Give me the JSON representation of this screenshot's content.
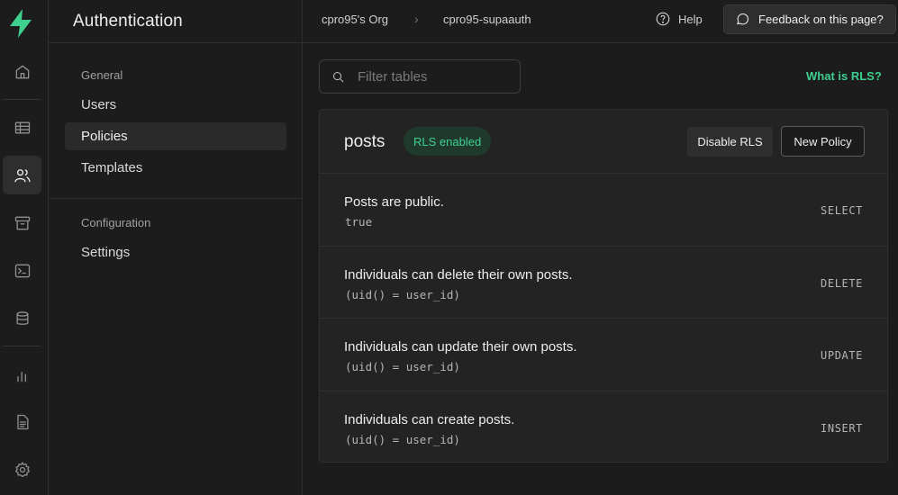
{
  "rail": {
    "icons": [
      "supabase-logo-icon",
      "home-icon",
      "table-editor-icon",
      "users-icon",
      "storage-icon",
      "sql-editor-icon",
      "database-icon",
      "reports-icon",
      "docs-icon",
      "settings-gear-icon"
    ],
    "active": "users-icon",
    "brand_color": "#3ecf8e"
  },
  "sidebar": {
    "title": "Authentication",
    "groups": [
      {
        "label": "General",
        "items": [
          "Users",
          "Policies",
          "Templates"
        ]
      },
      {
        "label": "Configuration",
        "items": [
          "Settings"
        ]
      }
    ],
    "active_item": "Policies"
  },
  "topbar": {
    "org": "cpro95's Org",
    "separator": "›",
    "project": "cpro95-supaauth",
    "help_label": "Help",
    "feedback_label": "Feedback on this page?"
  },
  "main": {
    "filter_placeholder": "Filter tables",
    "rls_link": "What is RLS?",
    "table": {
      "name": "posts",
      "badge": "RLS enabled",
      "disable_button": "Disable RLS",
      "new_policy_button": "New Policy",
      "policies": [
        {
          "name": "Posts are public.",
          "expr": "true",
          "command": "SELECT"
        },
        {
          "name": "Individuals can delete their own posts.",
          "expr": "(uid() = user_id)",
          "command": "DELETE"
        },
        {
          "name": "Individuals can update their own posts.",
          "expr": "(uid() = user_id)",
          "command": "UPDATE"
        },
        {
          "name": "Individuals can create posts.",
          "expr": "(uid() = user_id)",
          "command": "INSERT"
        }
      ]
    }
  }
}
